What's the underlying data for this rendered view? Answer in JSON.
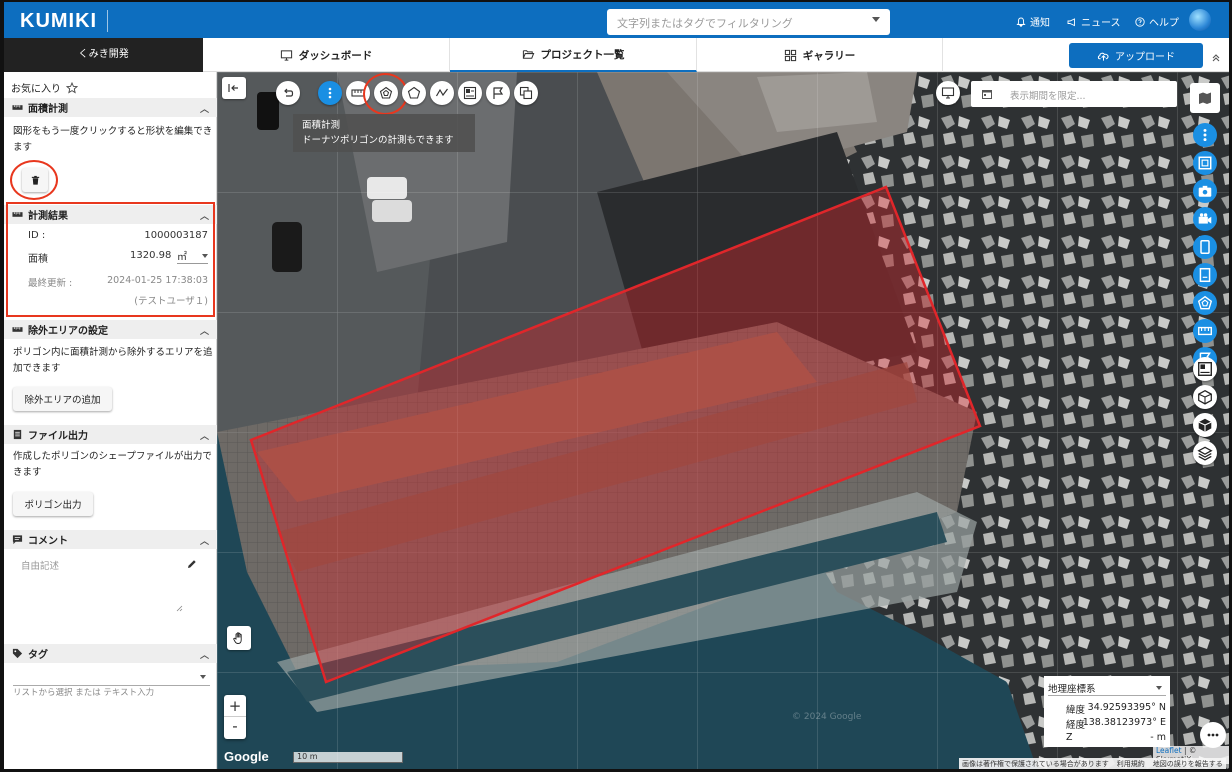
{
  "header": {
    "logo": "KUMIKI",
    "search_placeholder": "文字列またはタグでフィルタリング",
    "links": {
      "notify": "通知",
      "news": "ニュース",
      "help": "ヘルプ"
    }
  },
  "nav": {
    "project": "くみき開発",
    "tabs": {
      "dashboard": "ダッシュボード",
      "projects": "プロジェクト一覧",
      "gallery": "ギャラリー"
    },
    "upload": "アップロード"
  },
  "panel": {
    "favorite": "お気に入り",
    "area_measure": {
      "title": "面積計測",
      "hint": "図形をもう一度クリックすると形状を編集できます"
    },
    "result": {
      "title": "計測結果",
      "id_label": "ID :",
      "id_value": "1000003187",
      "area_label": "面積",
      "area_value": "1320.98",
      "area_unit": "㎡",
      "updated_label": "最終更新 :",
      "updated_value": "2024-01-25 17:38:03",
      "user": "(テストユーザ１)"
    },
    "exclude": {
      "title": "除外エリアの設定",
      "text": "ポリゴン内に面積計測から除外するエリアを追加できます",
      "button": "除外エリアの追加"
    },
    "file_output": {
      "title": "ファイル出力",
      "text": "作成したポリゴンのシェープファイルが出力できます",
      "button": "ポリゴン出力"
    },
    "comment": {
      "title": "コメント",
      "placeholder": "自由記述"
    },
    "tags": {
      "title": "タグ",
      "hint": "リストから選択 または テキスト入力"
    }
  },
  "map": {
    "tooltip_title": "面積計測",
    "tooltip_text": "ドーナツポリゴンの計測もできます",
    "period_placeholder": "表示期間を限定...",
    "coord_system": "地理座標系",
    "lat_label": "緯度",
    "lat_value": "34.92593395° N",
    "lon_label": "経度",
    "lon_value": "138.38123973° E",
    "z_label": "Z",
    "z_value": "- m",
    "scale": "10 m",
    "google": "Google",
    "attribution_leaflet": "Leaflet",
    "attribution_skymatix": "| © SkymatiX",
    "footer_copyright": "画像は著作権で保護されている場合があります",
    "footer_terms": "利用規約",
    "footer_report": "地図の誤りを報告する",
    "watermark": "© 2024 Google",
    "zoom_in": "+",
    "zoom_out": "-"
  },
  "colors": {
    "brand": "#0d6ebf",
    "accent_blue": "#1a8fe3",
    "highlight_red": "#e8371e",
    "polygon_red": "#e0262a"
  }
}
